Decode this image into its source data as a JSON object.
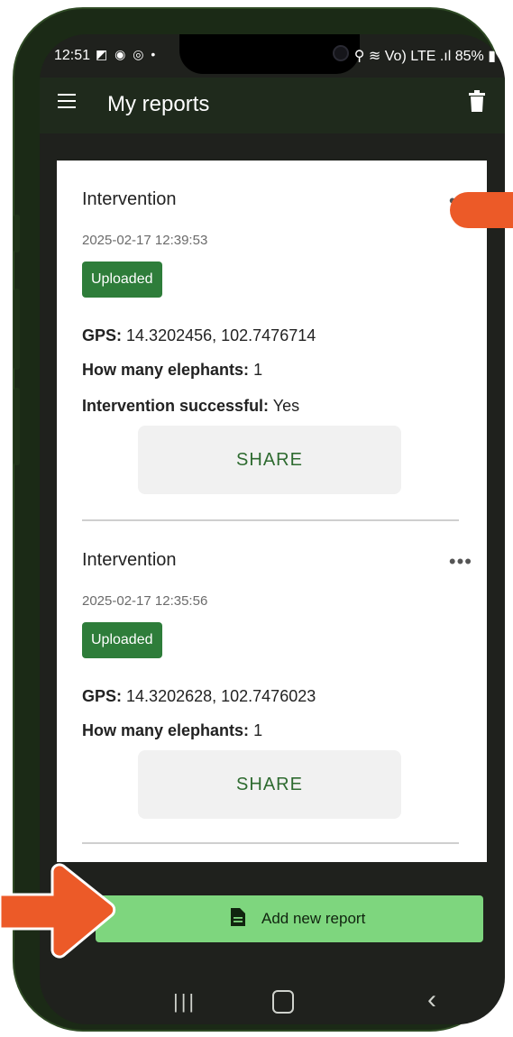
{
  "status_bar": {
    "time": "12:51",
    "left_icons": "◩ ◉ ◎ •",
    "right_text": "⚲ ≋ Vo) LTE .ıl 85% ▮"
  },
  "app_bar": {
    "title": "My reports"
  },
  "reports": [
    {
      "title": "Intervention",
      "date": "2025-02-17 12:39:53",
      "status": "Uploaded",
      "gps_label": "GPS:",
      "gps_value": "14.3202456, 102.7476714",
      "elephants_label": "How many elephants:",
      "elephants_value": "1",
      "success_label": "Intervention successful:",
      "success_value": "Yes",
      "share_label": "SHARE",
      "more": "•••"
    },
    {
      "title": "Intervention",
      "date": "2025-02-17 12:35:56",
      "status": "Uploaded",
      "gps_label": "GPS:",
      "gps_value": "14.3202628, 102.7476023",
      "elephants_label": "How many elephants:",
      "elephants_value": "1",
      "share_label": "SHARE",
      "more": "•••"
    }
  ],
  "add_button": {
    "label": "Add new report"
  },
  "nav": {
    "recent": "|||",
    "back": "‹"
  },
  "colors": {
    "accent": "#2e7d3a",
    "add_button": "#7ed67e",
    "arrow": "#ec5a28",
    "app_bar": "#1f2a1c"
  }
}
